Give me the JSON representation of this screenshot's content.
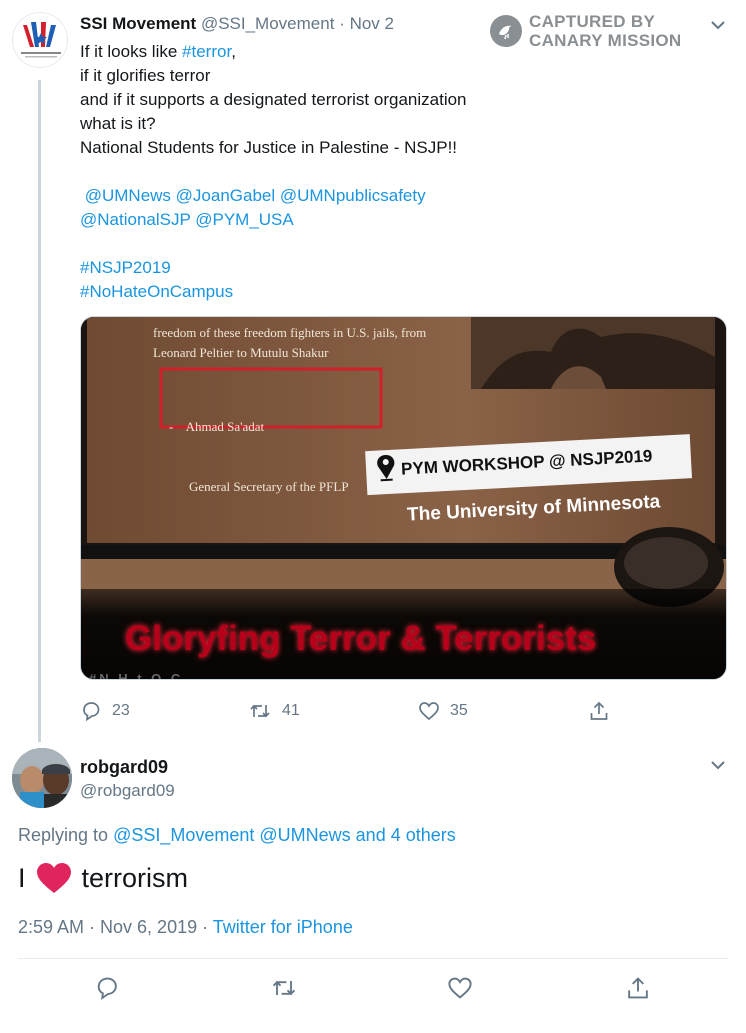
{
  "tweet": {
    "author_name": "SSI Movement",
    "author_handle": "@SSI_Movement",
    "separator": "·",
    "date": "Nov 2",
    "text_lines": [
      "If it looks like ",
      "#terror",
      ",",
      "if it glorifies terror",
      "and if it supports a designated terrorist organization",
      "what is it?",
      "National Students for Justice in Palestine - NSJP!!"
    ],
    "mentions_line1": " @UMNews @JoanGabel @UMNpublicsafety",
    "mentions_line2": "@NationalSJP @PYM_USA",
    "hashtag1": "#NSJP2019",
    "hashtag2": "#NoHateOnCampus",
    "media": {
      "slide_line1": "freedom of these freedom fighters in U.S. jails, from",
      "slide_line2": "Leonard Peltier to Mutulu Shakur",
      "box_line1": "-    Ahmad Sa'adat",
      "box_line2": "General Secretary of the PFLP",
      "workshop_label": "PYM WORKSHOP @ NSJP2019",
      "university": "The University of Minnesota",
      "overlay_title": "Gloryfing Terror & Terrorists",
      "bottom_partial": "#N H t O C"
    },
    "counts": {
      "replies": "23",
      "retweets": "41",
      "likes": "35"
    }
  },
  "watermark": {
    "line1": "CAPTURED BY",
    "line2": "CANARY MISSION"
  },
  "reply": {
    "author_name": "robgard09",
    "author_handle": "@robgard09",
    "replying_prefix": "Replying to ",
    "replying_to": "@SSI_Movement @UMNews and 4 others",
    "text_before": "I",
    "text_after": "terrorism",
    "time": "2:59 AM · Nov 6, 2019",
    "separator": " · ",
    "source": "Twitter for iPhone"
  },
  "colors": {
    "link": "#1b95e0",
    "muted": "#657786",
    "heart": "#e0245e",
    "overlay_red": "#c0001a"
  }
}
